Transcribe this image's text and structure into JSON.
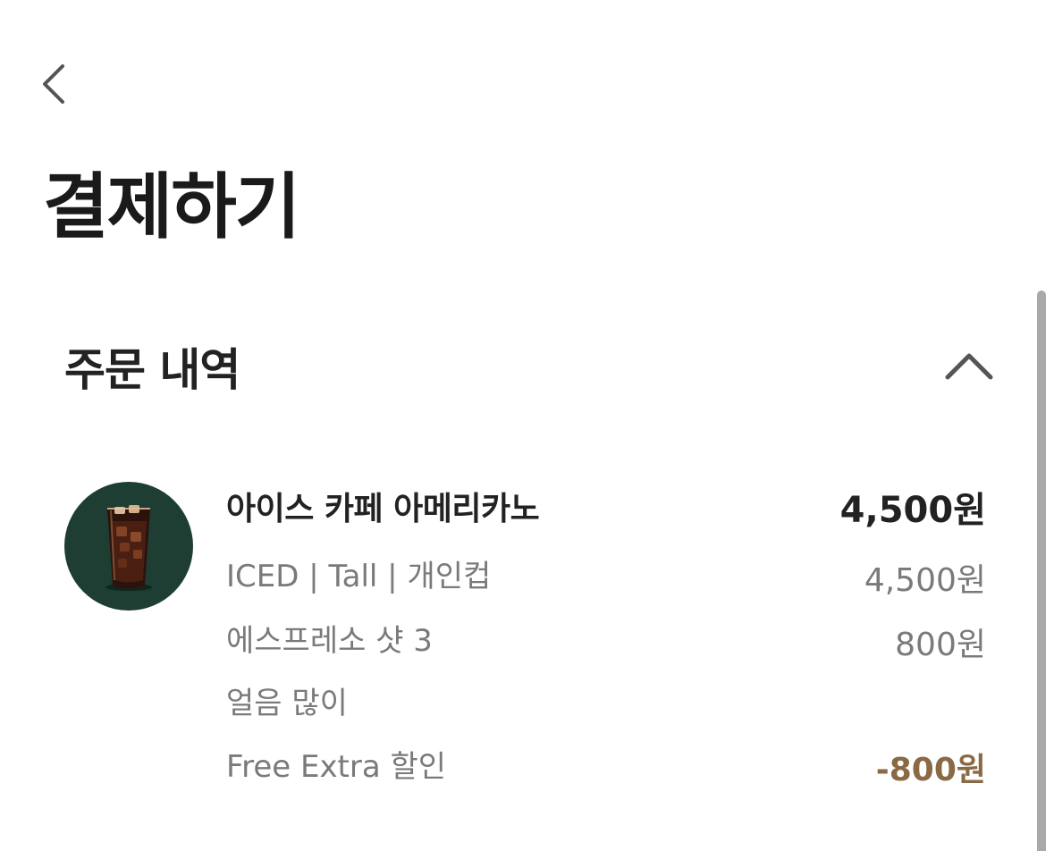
{
  "header": {
    "title": "결제하기"
  },
  "order_section": {
    "title": "주문 내역",
    "expanded": true,
    "items": [
      {
        "name": "아이스 카페 아메리카노",
        "price": "4,500원",
        "image": "iced-americano-cup",
        "options": [
          {
            "label": "ICED | Tall | 개인컵",
            "price": "4,500원"
          },
          {
            "label": "에스프레소 샷 3",
            "price": "800원"
          },
          {
            "label": "얼음 많이",
            "price": ""
          },
          {
            "label": "Free Extra 할인",
            "price": "-800원"
          }
        ]
      }
    ]
  },
  "colors": {
    "background": "#ffffff",
    "text_primary": "#222222",
    "text_secondary": "#7a7a7a",
    "discount": "#8a6a44",
    "thumbnail_background": "#1e3d33",
    "scrollbar": "#a9a9a9"
  },
  "icons": {
    "back": "chevron-left-icon",
    "collapse": "chevron-up-icon"
  }
}
